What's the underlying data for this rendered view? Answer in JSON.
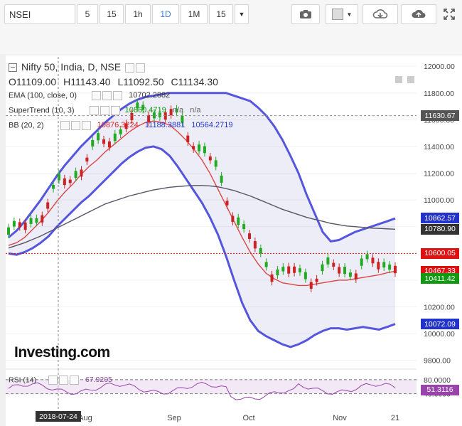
{
  "toolbar": {
    "symbol": "NSEI",
    "intervals": [
      "5",
      "15",
      "1h",
      "1D",
      "1M",
      "15"
    ],
    "active_interval": "1D"
  },
  "legend": {
    "title": "Nifty 50, India, D, NSE",
    "ohlc": {
      "o": "O11109.00",
      "h": "H11143.40",
      "l": "L11092.50",
      "c": "C11134.30"
    },
    "ema": {
      "label": "EMA (100, close, 0)",
      "value": "10702.2882"
    },
    "supertrend": {
      "label": "SuperTrend (10, 3)",
      "value": "10860.4719",
      "na1": "n/a",
      "na2": "n/a"
    },
    "bb": {
      "label": "BB (20, 2)",
      "v1": "10876.3224",
      "v2": "11188.3881",
      "v3": "10564.2719"
    },
    "rsi": {
      "label": "RSI (14)",
      "value": "67.9205"
    }
  },
  "logo": "Investing.com",
  "price_tags": [
    {
      "text": "11630.67",
      "value": 11630.67,
      "color": "#555555"
    },
    {
      "text": "10862.57",
      "value": 10862.57,
      "color": "#2233cc"
    },
    {
      "text": "10780.90",
      "value": 10780.9,
      "color": "#333333"
    },
    {
      "text": "10600.05",
      "value": 10600.05,
      "color": "#dd1111"
    },
    {
      "text": "10467.33",
      "value": 10467.33,
      "color": "#dd1111"
    },
    {
      "text": "10411.42",
      "value": 10411.42,
      "color": "#119911"
    },
    {
      "text": "10072.09",
      "value": 10072.09,
      "color": "#2233cc"
    }
  ],
  "rsi_tag": {
    "text": "51.3116",
    "value": 51.3116
  },
  "crosshair_date": "2018-07-24",
  "chart_data": {
    "type": "line",
    "y_ticks": [
      "12000.00",
      "11800.00",
      "11600.00",
      "11400.00",
      "11200.00",
      "11000.00",
      "10800.00",
      "10600.00",
      "10400.00",
      "10200.00",
      "10000.00",
      "9800.00"
    ],
    "y_values": [
      12000,
      11800,
      11600,
      11400,
      11200,
      11000,
      10800,
      10600,
      10400,
      10200,
      10000,
      9800
    ],
    "ylim": [
      9740,
      12070
    ],
    "x_labels": [
      "Aug",
      "Sep",
      "Oct",
      "Nov",
      "21"
    ],
    "rsi_ticks": [
      "80.0000",
      "40.0000"
    ],
    "rsi_values": [
      80,
      40
    ],
    "series": [
      {
        "name": "BB upper",
        "color": "#5555dd",
        "values": [
          10720,
          10770,
          10840,
          10920,
          11000,
          11090,
          11180,
          11260,
          11330,
          11400,
          11460,
          11520,
          11580,
          11630,
          11680,
          11720,
          11750,
          11770,
          11780,
          11790,
          11800,
          11800,
          11800,
          11800,
          11800,
          11800,
          11800,
          11800,
          11780,
          11760,
          11740,
          11690,
          11630,
          11550,
          11450,
          11330,
          11200,
          11040,
          10900,
          10760,
          10690,
          10700,
          10730,
          10760,
          10780,
          10800,
          10820,
          10840,
          10862
        ]
      },
      {
        "name": "BB lower",
        "color": "#5555dd",
        "values": [
          10600,
          10590,
          10610,
          10640,
          10680,
          10730,
          10800,
          10860,
          10920,
          10980,
          11030,
          11090,
          11150,
          11210,
          11270,
          11320,
          11360,
          11390,
          11400,
          11380,
          11330,
          11250,
          11160,
          11070,
          10980,
          10870,
          10740,
          10580,
          10400,
          10230,
          10100,
          10020,
          9980,
          9950,
          9920,
          9900,
          9920,
          9950,
          9990,
          10020,
          10040,
          10040,
          10030,
          10040,
          10050,
          10040,
          10030,
          10050,
          10072
        ]
      },
      {
        "name": "BB basis",
        "color": "#dd4444",
        "values": [
          10660,
          10680,
          10720,
          10780,
          10840,
          10910,
          10990,
          11060,
          11120,
          11190,
          11250,
          11300,
          11360,
          11410,
          11460,
          11510,
          11550,
          11580,
          11590,
          11580,
          11560,
          11510,
          11450,
          11380,
          11300,
          11200,
          11080,
          10960,
          10840,
          10720,
          10610,
          10520,
          10450,
          10410,
          10380,
          10370,
          10360,
          10360,
          10370,
          10380,
          10390,
          10400,
          10400,
          10410,
          10420,
          10430,
          10440,
          10455,
          10467
        ]
      },
      {
        "name": "EMA",
        "color": "#555566",
        "values": [
          10640,
          10660,
          10680,
          10705,
          10730,
          10760,
          10790,
          10820,
          10850,
          10880,
          10910,
          10940,
          10970,
          10990,
          11010,
          11030,
          11045,
          11060,
          11075,
          11085,
          11095,
          11100,
          11105,
          11108,
          11108,
          11105,
          11098,
          11085,
          11070,
          11050,
          11030,
          11005,
          10980,
          10955,
          10930,
          10910,
          10890,
          10870,
          10855,
          10840,
          10825,
          10815,
          10805,
          10800,
          10795,
          10790,
          10787,
          10784,
          10781
        ]
      }
    ]
  }
}
